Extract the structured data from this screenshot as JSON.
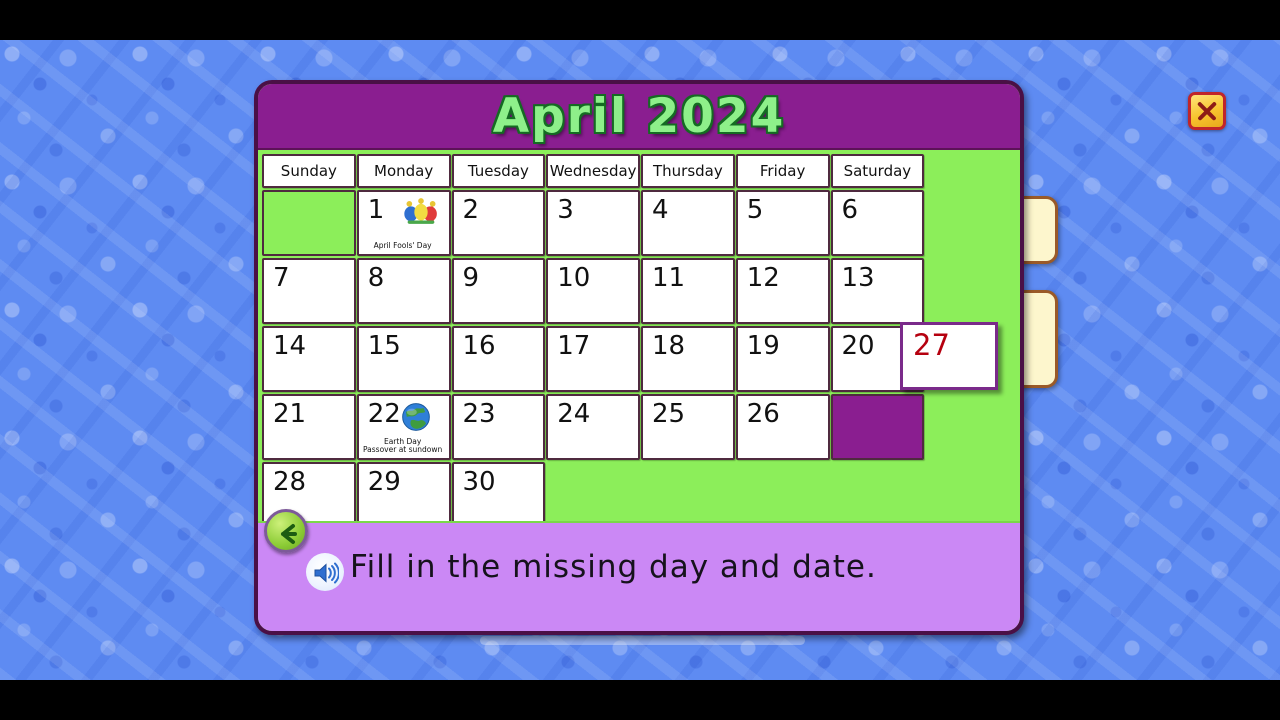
{
  "window": {
    "close_label": "×"
  },
  "calendar": {
    "title": "April 2024",
    "weekday_headers": [
      "Sunday",
      "Monday",
      "Tuesday",
      "Wednesday",
      "Thursday",
      "Friday",
      "Saturday"
    ],
    "weeks": [
      [
        {
          "num": "",
          "type": "blank"
        },
        {
          "num": "1",
          "type": "day",
          "holiday": "April Fools' Day",
          "icon": "jester-hat-icon"
        },
        {
          "num": "2",
          "type": "day"
        },
        {
          "num": "3",
          "type": "day"
        },
        {
          "num": "4",
          "type": "day"
        },
        {
          "num": "5",
          "type": "day"
        },
        {
          "num": "6",
          "type": "day"
        }
      ],
      [
        {
          "num": "7",
          "type": "day"
        },
        {
          "num": "8",
          "type": "day"
        },
        {
          "num": "9",
          "type": "day"
        },
        {
          "num": "10",
          "type": "day"
        },
        {
          "num": "11",
          "type": "day"
        },
        {
          "num": "12",
          "type": "day"
        },
        {
          "num": "13",
          "type": "day"
        }
      ],
      [
        {
          "num": "14",
          "type": "day"
        },
        {
          "num": "15",
          "type": "day"
        },
        {
          "num": "16",
          "type": "day"
        },
        {
          "num": "17",
          "type": "day"
        },
        {
          "num": "18",
          "type": "day"
        },
        {
          "num": "19",
          "type": "day"
        },
        {
          "num": "20",
          "type": "day"
        }
      ],
      [
        {
          "num": "21",
          "type": "day"
        },
        {
          "num": "22",
          "type": "day",
          "holiday": "Earth Day",
          "holiday2": "Passover at sundown",
          "icon": "earth-globe-icon"
        },
        {
          "num": "23",
          "type": "day"
        },
        {
          "num": "24",
          "type": "day"
        },
        {
          "num": "25",
          "type": "day"
        },
        {
          "num": "26",
          "type": "day"
        },
        {
          "num": "",
          "type": "target"
        }
      ],
      [
        {
          "num": "28",
          "type": "day"
        },
        {
          "num": "29",
          "type": "day"
        },
        {
          "num": "30",
          "type": "day"
        },
        {
          "num": "",
          "type": "filler"
        },
        {
          "num": "",
          "type": "filler"
        },
        {
          "num": "",
          "type": "filler"
        },
        {
          "num": "",
          "type": "filler"
        }
      ]
    ]
  },
  "answer_tile": {
    "value": "27"
  },
  "side_cards": [
    {
      "label": ""
    },
    {
      "label": ""
    }
  ],
  "instruction": {
    "text": "Fill in the missing day and date.",
    "speaker_icon": "speaker-icon",
    "back_icon": "back-arrow-icon"
  },
  "colors": {
    "header_purple": "#8a1e90",
    "panel_green": "#8cee5a",
    "title_green": "#8ef08a",
    "title_outline": "#146b22",
    "instruction_purple": "#cb88f5",
    "answer_red": "#b5000f",
    "card_cream": "#fdf6cd",
    "card_border_brown": "#9a5a28",
    "backdrop_blue": "#5e8bf2"
  }
}
